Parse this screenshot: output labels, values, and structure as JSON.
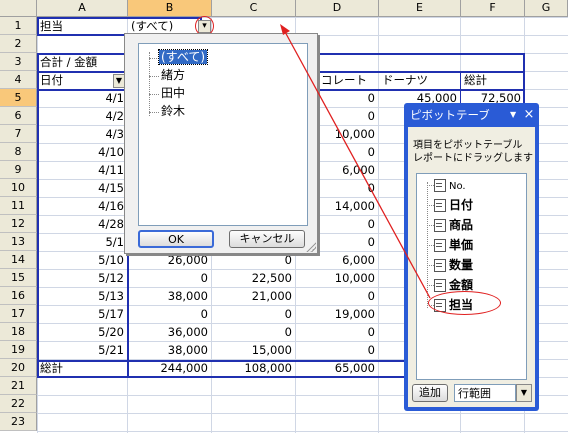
{
  "columns": [
    "A",
    "B",
    "C",
    "D",
    "E",
    "F",
    "G"
  ],
  "rows": [
    "1",
    "2",
    "3",
    "4",
    "5",
    "6",
    "7",
    "8",
    "9",
    "10",
    "11",
    "12",
    "13",
    "14",
    "15",
    "16",
    "17",
    "18",
    "19",
    "20",
    "21",
    "22",
    "23"
  ],
  "sheet": {
    "a1": "担当",
    "b1": "(すべて)",
    "a3": "合計 / 金額",
    "a4": "日付",
    "d4": "コレート",
    "e4": "ドーナツ",
    "f4": "総計",
    "a20": "総計",
    "dates": [
      "4/1",
      "4/2",
      "4/3",
      "4/10",
      "4/11",
      "4/15",
      "4/16",
      "4/28",
      "5/1",
      "5/10",
      "5/12",
      "5/13",
      "5/17",
      "5/20",
      "5/21"
    ],
    "colB": [
      "",
      "",
      "",
      "",
      "",
      "",
      "",
      "",
      "",
      "26,000",
      "0",
      "38,000",
      "0",
      "36,000",
      "38,000",
      "244,000"
    ],
    "colC": [
      "",
      "",
      "",
      "",
      "",
      "",
      "",
      "",
      "",
      "0",
      "22,500",
      "21,000",
      "0",
      "0",
      "15,000",
      "108,000"
    ],
    "colD": [
      "0",
      "0",
      "10,000",
      "0",
      "6,000",
      "0",
      "14,000",
      "0",
      "0",
      "6,000",
      "10,000",
      "0",
      "19,000",
      "0",
      "0",
      "65,000"
    ],
    "colE": [
      "45,000",
      ""
    ],
    "colF": [
      "72,500",
      ""
    ]
  },
  "filter_dropdown": {
    "items": [
      "(すべて)",
      "緒方",
      "田中",
      "鈴木"
    ],
    "ok_label": "OK",
    "cancel_label": "キャンセル"
  },
  "pivot_pane": {
    "title": "ピボットテーブ",
    "close": "×",
    "description_line1": "項目をピボットテーブル",
    "description_line2": "レポートにドラッグします",
    "fields": [
      "No.",
      "日付",
      "商品",
      "単価",
      "数量",
      "金額",
      "担当"
    ],
    "add_label": "追加",
    "area_select": "行範囲"
  },
  "colors": {
    "accent": "#2a5bd6",
    "annotation": "#e02020",
    "header_bg": "#ece9d8",
    "selected_header": "#f9c87a"
  }
}
